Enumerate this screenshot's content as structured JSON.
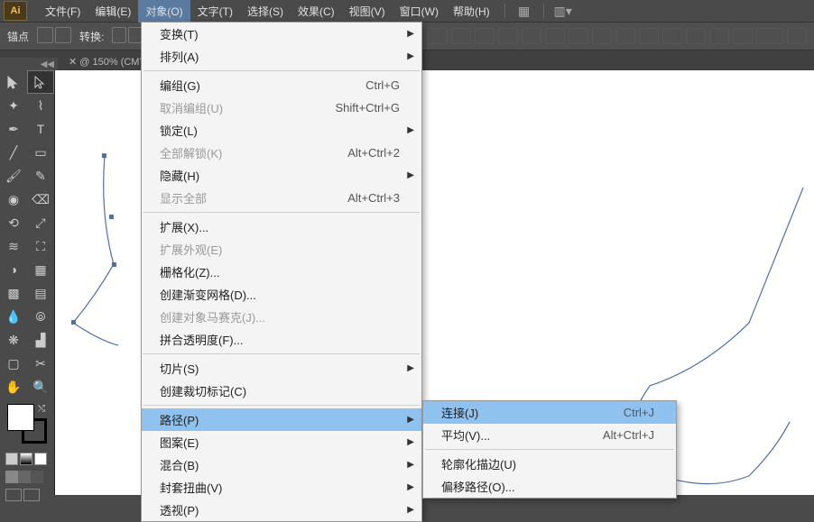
{
  "app_logo": "Ai",
  "menubar": {
    "file": "文件(F)",
    "edit": "编辑(E)",
    "object": "对象(O)",
    "type": "文字(T)",
    "select": "选择(S)",
    "effect": "效果(C)",
    "view": "视图(V)",
    "window": "窗口(W)",
    "help": "帮助(H)"
  },
  "optionsbar": {
    "anchor_label": "锚点",
    "convert_label": "转换:"
  },
  "document": {
    "tab_label": "@ 150% (CMY",
    "close": "✕",
    "collapse": "◀◀"
  },
  "object_menu": {
    "transform": "变换(T)",
    "arrange": "排列(A)",
    "group": "编组(G)",
    "group_sc": "Ctrl+G",
    "ungroup": "取消编组(U)",
    "ungroup_sc": "Shift+Ctrl+G",
    "lock": "锁定(L)",
    "unlock_all": "全部解锁(K)",
    "unlock_all_sc": "Alt+Ctrl+2",
    "hide": "隐藏(H)",
    "show_all": "显示全部",
    "show_all_sc": "Alt+Ctrl+3",
    "expand": "扩展(X)...",
    "expand_appearance": "扩展外观(E)",
    "rasterize": "栅格化(Z)...",
    "gradient_mesh": "创建渐变网格(D)...",
    "mosaic": "创建对象马赛克(J)...",
    "flatten": "拼合透明度(F)...",
    "slice": "切片(S)",
    "trim_marks": "创建裁切标记(C)",
    "path": "路径(P)",
    "pattern": "图案(E)",
    "blend": "混合(B)",
    "envelope": "封套扭曲(V)",
    "perspective": "透视(P)"
  },
  "path_submenu": {
    "join": "连接(J)",
    "join_sc": "Ctrl+J",
    "average": "平均(V)...",
    "average_sc": "Alt+Ctrl+J",
    "outline_stroke": "轮廓化描边(U)",
    "offset_path": "偏移路径(O)..."
  }
}
